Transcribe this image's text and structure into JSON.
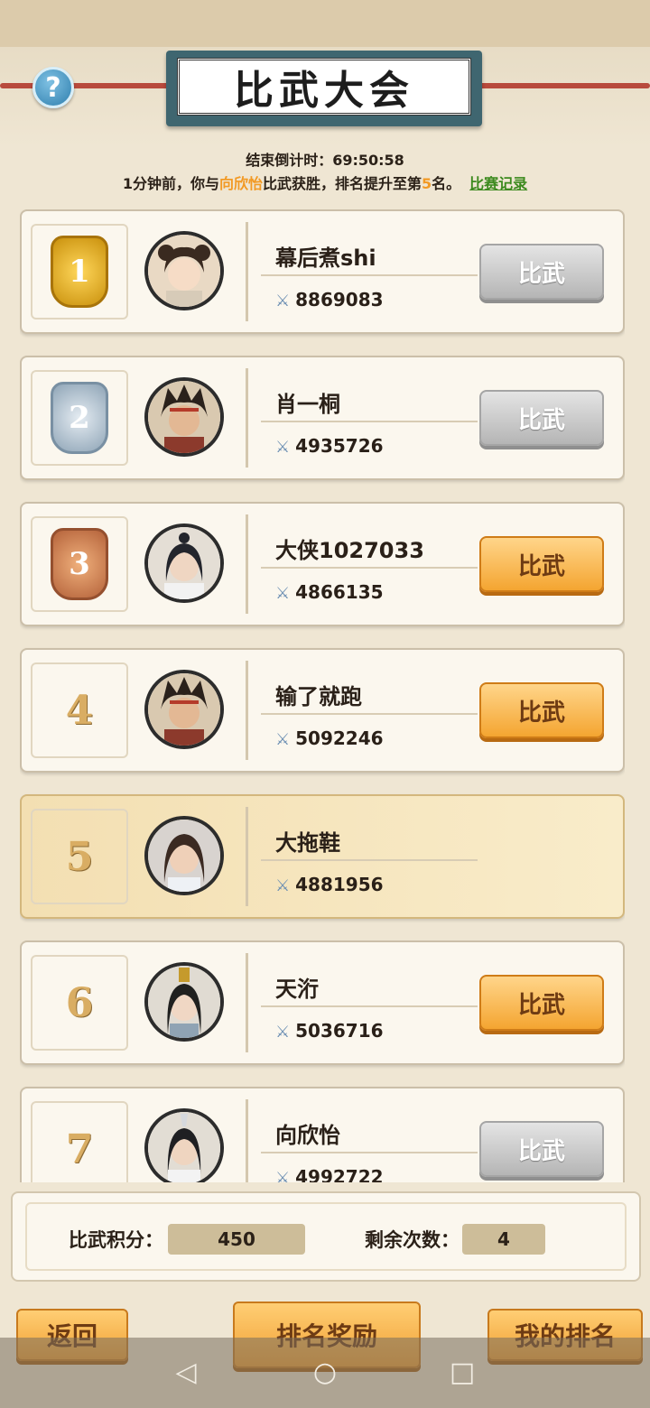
{
  "header": {
    "title": "比武大会",
    "help_icon": "?"
  },
  "status": {
    "countdown": "结束倒计时：69:50:58",
    "notice_pre": "1分钟前，你与",
    "notice_name": "向欣怡",
    "notice_mid": "比武获胜，排名提升至第",
    "notice_rank": "5",
    "notice_post": "名。",
    "record_link": "比赛记录"
  },
  "players": [
    {
      "rank": "1",
      "medal": "gold",
      "name": "幕后煮shi",
      "power": "8869083",
      "button": "比武",
      "enabled": false
    },
    {
      "rank": "2",
      "medal": "silver",
      "name": "肖一桐",
      "power": "4935726",
      "button": "比武",
      "enabled": false
    },
    {
      "rank": "3",
      "medal": "bronze",
      "name": "大侠1027033",
      "power": "4866135",
      "button": "比武",
      "enabled": true
    },
    {
      "rank": "4",
      "name": "输了就跑",
      "power": "5092246",
      "button": "比武",
      "enabled": true
    },
    {
      "rank": "5",
      "name": "大拖鞋",
      "power": "4881956",
      "is_self": true
    },
    {
      "rank": "6",
      "name": "天洐",
      "power": "5036716",
      "button": "比武",
      "enabled": true
    },
    {
      "rank": "7",
      "name": "向欣怡",
      "power": "4992722",
      "button": "比武",
      "enabled": false
    }
  ],
  "score": {
    "points_label": "比武积分：",
    "points_value": "450",
    "remaining_label": "剩余次数：",
    "remaining_value": "4"
  },
  "footer": {
    "back": "返回",
    "rewards": "排名奖励",
    "my_rank": "我的排名"
  },
  "system_nav": {
    "back_icon": "◁",
    "home_icon": "○",
    "recents_icon": "□"
  }
}
